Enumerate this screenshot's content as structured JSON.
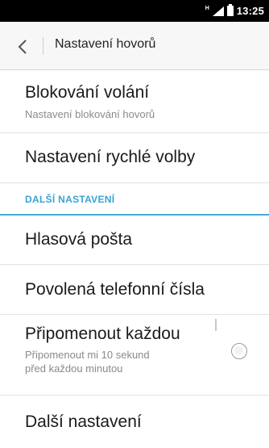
{
  "status_bar": {
    "network": "H",
    "time": "13:25"
  },
  "action_bar": {
    "title": "Nastavení hovorů"
  },
  "items": {
    "call_blocking": {
      "label": "Blokování volání",
      "summary": "Nastavení blokování hovorů"
    },
    "speed_dial": {
      "label": "Nastavení rychlé volby"
    },
    "section": {
      "label": "DALŠÍ NASTAVENÍ"
    },
    "voicemail": {
      "label": "Hlasová pošta"
    },
    "fixed_dialing": {
      "label": "Povolená telefonní čísla"
    },
    "minute_reminder": {
      "label": "Připomenout každou",
      "summary_line1": "Připomenout mi 10 sekund",
      "summary_line2": "před každou minutou",
      "checked": false
    },
    "more_settings": {
      "label": "Další nastavení"
    }
  }
}
